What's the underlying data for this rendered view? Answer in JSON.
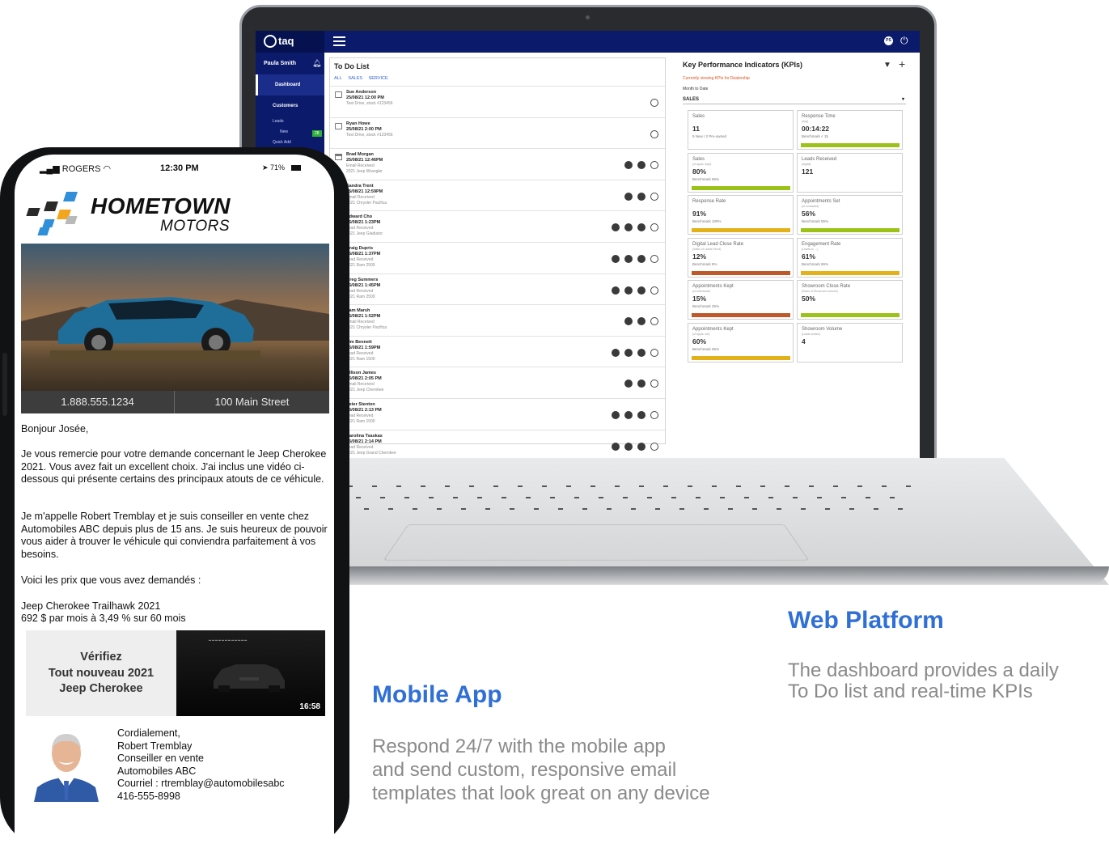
{
  "laptop": {
    "app_logo": "taq",
    "topbar_avatar": "PS",
    "sidebar": {
      "user": "Paula Smith",
      "items": [
        {
          "label": "Dashboard",
          "active": true
        },
        {
          "label": "Customers",
          "active": false
        }
      ],
      "sub_items": [
        "Leads",
        "New",
        "Quick Add"
      ],
      "new_badge": "28"
    },
    "todo": {
      "title": "To Do List",
      "tabs": [
        "ALL",
        "SALES",
        "SERVICE"
      ],
      "rows": [
        {
          "name": "Sue Anderson",
          "datetime": "25/08/21  12:00 PM",
          "line1": "Test Drive, stock #123456",
          "line2": "",
          "actions": 1
        },
        {
          "name": "Ryan Howe",
          "datetime": "25/08/21  2:00 PM",
          "line1": "Test Drive, stock #123456",
          "line2": "",
          "actions": 1
        },
        {
          "name": "Brad Morgan",
          "datetime": "25/08/21  12:46PM",
          "line1": "Email Received",
          "line2": "2021 Jeep Wrangler",
          "actions": 3
        },
        {
          "name": "Sandra Trent",
          "datetime": "25/08/21  12:59PM",
          "line1": "Email Received",
          "line2": "2021 Chrysler Pacifica",
          "actions": 3
        },
        {
          "name": "Edward Cho",
          "datetime": "25/08/21  1:23PM",
          "line1": "Lead Received",
          "line2": "2021 Jeep Gladiator",
          "actions": 4
        },
        {
          "name": "Craig Dupris",
          "datetime": "25/08/21  1:37PM",
          "line1": "Lead Received",
          "line2": "2021 Ram 2500",
          "actions": 4
        },
        {
          "name": "Greg Summers",
          "datetime": "25/08/21  1:45PM",
          "line1": "Lead Received",
          "line2": "2021 Ram 2500",
          "actions": 4
        },
        {
          "name": "Pam Marsh",
          "datetime": "25/08/21  1:52PM",
          "line1": "Email Received",
          "line2": "2021 Chrysler Pacifica",
          "actions": 3
        },
        {
          "name": "Tim Bennett",
          "datetime": "25/08/21  1:59PM",
          "line1": "Lead Received",
          "line2": "2021 Ram 1500",
          "actions": 4
        },
        {
          "name": "Allison James",
          "datetime": "25/08/21  2:05 PM",
          "line1": "Email Received",
          "line2": "2021 Jeep Cherokee",
          "actions": 3
        },
        {
          "name": "Peter Stenton",
          "datetime": "25/08/21  2:13 PM",
          "line1": "Lead Received",
          "line2": "2021 Ram 1500",
          "actions": 4
        },
        {
          "name": "Carolina Tsaskas",
          "datetime": "25/08/21  2:14 PM",
          "line1": "Lead Received",
          "line2": "2021 Jeep Grand Cherokee",
          "actions": 4
        }
      ]
    },
    "kpi": {
      "title": "Key Performance Indicators (KPIs)",
      "note": "Currently viewing KPIs for Dealership",
      "period": "Month to Date",
      "select": "SALES",
      "cards": [
        {
          "label": "Sales",
          "sub": "",
          "value": "11",
          "bench": "9 New / 2 Pre-owned",
          "bar": 0,
          "color": "#ffffff"
        },
        {
          "label": "Response Time",
          "sub": "(Avg)",
          "value": "00:14:22",
          "bench": "Benchmark < 15",
          "bar": 1,
          "color": "#9cc21a"
        },
        {
          "label": "Sales",
          "sub": "(of appts. kept)",
          "value": "80%",
          "bench": "Benchmark 65%",
          "bar": 1,
          "color": "#9cc21a"
        },
        {
          "label": "Leads Received",
          "sub": "(digital)",
          "value": "121",
          "bench": "",
          "bar": 0,
          "color": "#ffffff"
        },
        {
          "label": "Response Rate",
          "sub": "",
          "value": "91%",
          "bench": "Benchmark 100%",
          "bar": 1,
          "color": "#e3b21a"
        },
        {
          "label": "Appointments Set",
          "sub": "(of contacted)",
          "value": "56%",
          "bench": "Benchmark 55%",
          "bar": 1,
          "color": "#9cc21a"
        },
        {
          "label": "Digital Lead Close Rate",
          "sub": "(Sales of Leads Rec'd)",
          "value": "12%",
          "bench": "Benchmark 8%",
          "bar": 1,
          "color": "#c0592a"
        },
        {
          "label": "Engagement Rate",
          "sub": "(Leads to ...)",
          "value": "61%",
          "bench": "Benchmark 65%",
          "bar": 1,
          "color": "#e3b21a"
        },
        {
          "label": "Appointments Kept",
          "sub": "(of total leads)",
          "value": "15%",
          "bench": "Benchmark 25%",
          "bar": 1,
          "color": "#c0592a"
        },
        {
          "label": "Showroom Close Rate",
          "sub": "(Sales of Showroom volume)",
          "value": "50%",
          "bench": "",
          "bar": 1,
          "color": "#9cc21a"
        },
        {
          "label": "Appointments Kept",
          "sub": "(of appts. set)",
          "value": "60%",
          "bench": "Benchmark 65%",
          "bar": 1,
          "color": "#e3b21a"
        },
        {
          "label": "Showroom Volume",
          "sub": "(Leads visited)",
          "value": "4",
          "bench": "",
          "bar": 0,
          "color": "#ffffff"
        }
      ]
    }
  },
  "phone": {
    "status": {
      "carrier": "ROGERS",
      "time": "12:30 PM",
      "battery": "71%"
    },
    "brand": {
      "line1": "HOMETOWN",
      "line2": "MOTORS"
    },
    "contact": {
      "phone": "1.888.555.1234",
      "address": "100 Main Street"
    },
    "email": {
      "greeting": "Bonjour Josée,",
      "p1": "Je vous remercie pour votre demande concernant le Jeep Cherokee 2021. Vous avez fait un excellent choix. J'ai inclus une vidéo ci-dessous qui présente certains des principaux atouts de ce véhicule.",
      "p2": "Je m'appelle Robert Tremblay et je suis conseiller en vente chez Automobiles ABC depuis plus de 15 ans. Je suis heureux de pouvoir vous aider à trouver le véhicule qui conviendra parfaitement à vos besoins.",
      "p3": "Voici les prix que vous avez demandés :",
      "price_title": "Jeep Cherokee Trailhawk 2021",
      "price_detail": "692 $ par mois à 3,49 % sur 60 mois"
    },
    "video": {
      "line1": "Vérifiez",
      "line2": "Tout nouveau 2021",
      "line3": "Jeep Cherokee",
      "duration": "16:58"
    },
    "signature": [
      "Cordialement,",
      "Robert Tremblay",
      "Conseiller en vente",
      "Automobiles ABC",
      "Courriel : rtremblay@automobilesabc",
      "416-555-8998"
    ]
  },
  "marketing": {
    "web_heading": "Web Platform",
    "web_text_1": "The dashboard provides a daily",
    "web_text_2": "To Do list and real-time KPIs",
    "mobile_heading": "Mobile App",
    "mobile_text_1": "Respond 24/7 with the mobile app",
    "mobile_text_2": "and send custom, responsive email",
    "mobile_text_3": "templates that look great on any device"
  }
}
